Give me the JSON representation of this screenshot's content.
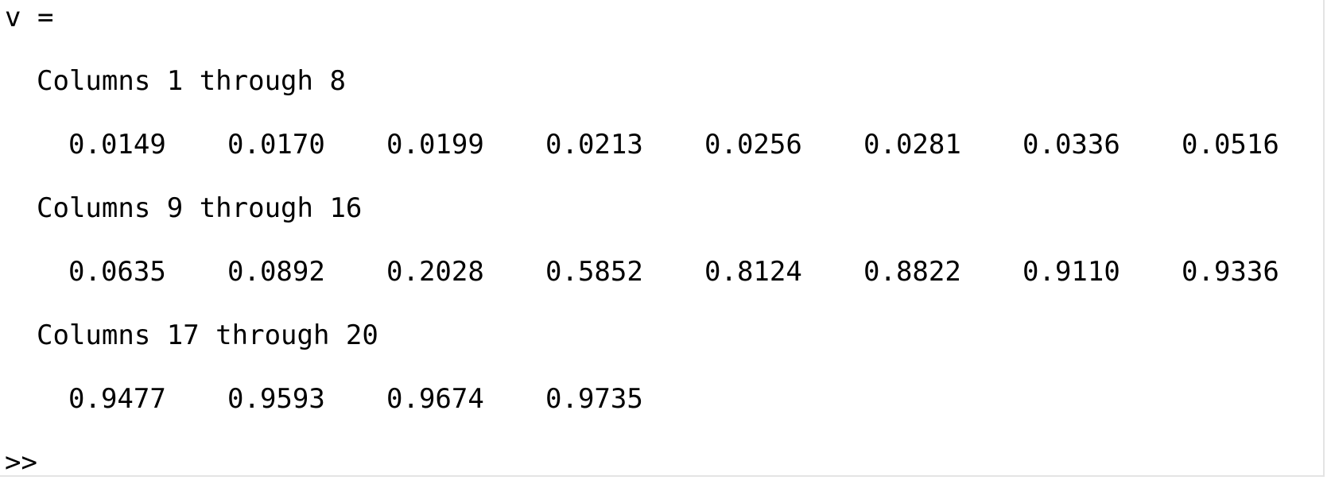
{
  "console": {
    "variable_line": "v =",
    "blocks": [
      {
        "header": "Columns 1 through 8",
        "values": [
          "0.0149",
          "0.0170",
          "0.0199",
          "0.0213",
          "0.0256",
          "0.0281",
          "0.0336",
          "0.0516"
        ]
      },
      {
        "header": "Columns 9 through 16",
        "values": [
          "0.0635",
          "0.0892",
          "0.2028",
          "0.5852",
          "0.8124",
          "0.8822",
          "0.9110",
          "0.9336"
        ]
      },
      {
        "header": "Columns 17 through 20",
        "values": [
          "0.9477",
          "0.9593",
          "0.9674",
          "0.9735"
        ]
      }
    ],
    "prompt": ">>",
    "input_value": ""
  },
  "colors": {
    "background": "#ffffff",
    "text": "#000000",
    "border": "#e4e4e4"
  }
}
